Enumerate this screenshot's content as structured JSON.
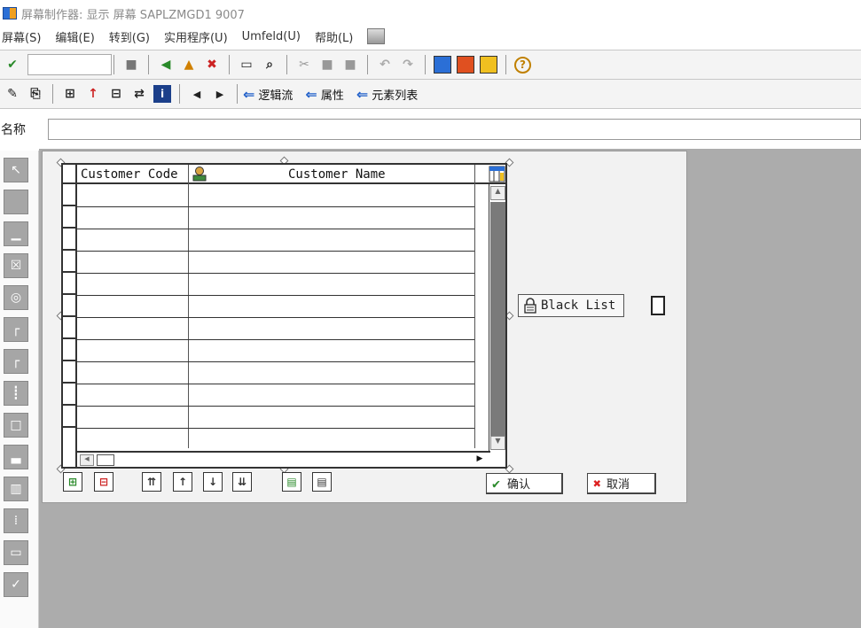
{
  "title": "屏幕制作器:  显示 屏幕 SAPLZMGD1 9007",
  "menu": [
    "屏幕(S)",
    "编辑(E)",
    "转到(G)",
    "实用程序(U)",
    "Umfeld(U)",
    "帮助(L)"
  ],
  "toolbar2_links": [
    {
      "label": "逻辑流",
      "icon": "left-arrow-icon"
    },
    {
      "label": "属性",
      "icon": "left-arrow-icon"
    },
    {
      "label": "元素列表",
      "icon": "left-arrow-icon"
    }
  ],
  "name_label": "名称",
  "name_value": "",
  "table": {
    "columns": [
      "Customer Code",
      "Customer Name"
    ],
    "rows": 12
  },
  "blacklist_label": "Black List",
  "ok_label": "确认",
  "cancel_label": "取消",
  "colors": {
    "workarea": "#acacac",
    "accent": "#1f5fc9"
  }
}
